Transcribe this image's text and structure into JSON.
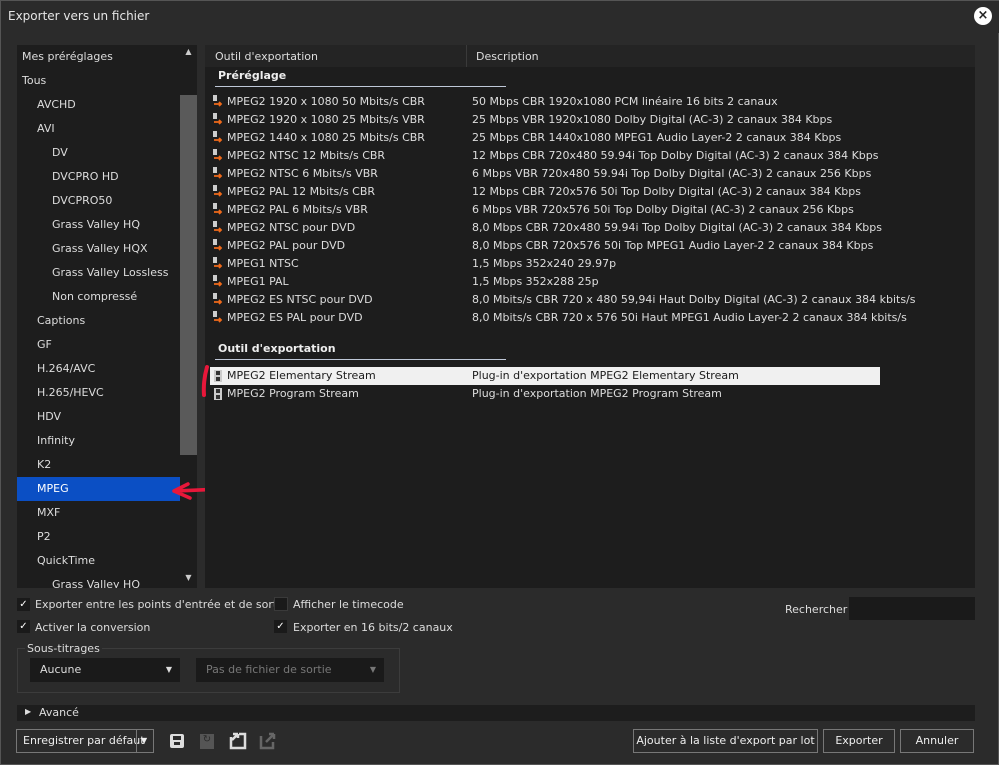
{
  "window": {
    "title": "Exporter vers un fichier",
    "close_icon": "close-icon"
  },
  "tree": {
    "items": [
      {
        "label": "Mes préréglages",
        "level": 0
      },
      {
        "label": "Tous",
        "level": 0
      },
      {
        "label": "AVCHD",
        "level": 1
      },
      {
        "label": "AVI",
        "level": 1
      },
      {
        "label": "DV",
        "level": 2
      },
      {
        "label": "DVCPRO HD",
        "level": 2
      },
      {
        "label": "DVCPRO50",
        "level": 2
      },
      {
        "label": "Grass Valley HQ",
        "level": 2
      },
      {
        "label": "Grass Valley HQX",
        "level": 2
      },
      {
        "label": "Grass Valley Lossless",
        "level": 2
      },
      {
        "label": "Non compressé",
        "level": 2
      },
      {
        "label": "Captions",
        "level": 1
      },
      {
        "label": "GF",
        "level": 1
      },
      {
        "label": "H.264/AVC",
        "level": 1
      },
      {
        "label": "H.265/HEVC",
        "level": 1
      },
      {
        "label": "HDV",
        "level": 1
      },
      {
        "label": "Infinity",
        "level": 1
      },
      {
        "label": "K2",
        "level": 1
      },
      {
        "label": "MPEG",
        "level": 1,
        "selected": true
      },
      {
        "label": "MXF",
        "level": 1
      },
      {
        "label": "P2",
        "level": 1
      },
      {
        "label": "QuickTime",
        "level": 1
      },
      {
        "label": "Grass Valley HQ",
        "level": 2
      }
    ]
  },
  "table": {
    "col_tool": "Outil d'exportation",
    "col_desc": "Description",
    "presets_title": "Préréglage",
    "presets": [
      {
        "name": "MPEG2 1920 x 1080 50 Mbits/s CBR",
        "desc": "50 Mbps CBR 1920x1080 PCM linéaire 16 bits 2 canaux"
      },
      {
        "name": "MPEG2 1920 x 1080 25 Mbits/s VBR",
        "desc": "25 Mbps VBR 1920x1080 Dolby Digital (AC-3) 2 canaux 384 Kbps"
      },
      {
        "name": "MPEG2 1440 x 1080 25 Mbits/s CBR",
        "desc": "25 Mbps CBR 1440x1080 MPEG1 Audio Layer-2 2 canaux 384 Kbps"
      },
      {
        "name": "MPEG2 NTSC 12 Mbits/s CBR",
        "desc": "12 Mbps CBR 720x480 59.94i Top Dolby Digital (AC-3) 2 canaux 384 Kbps"
      },
      {
        "name": "MPEG2 NTSC 6 Mbits/s VBR",
        "desc": "6 Mbps VBR 720x480 59.94i Top Dolby Digital (AC-3) 2 canaux 256 Kbps"
      },
      {
        "name": "MPEG2 PAL 12 Mbits/s CBR",
        "desc": "12 Mbps CBR 720x576 50i Top Dolby Digital (AC-3) 2 canaux 384 Kbps"
      },
      {
        "name": "MPEG2 PAL 6 Mbits/s VBR",
        "desc": "6 Mbps VBR 720x576 50i Top Dolby Digital (AC-3) 2 canaux 256 Kbps"
      },
      {
        "name": "MPEG2 NTSC pour DVD",
        "desc": "8,0 Mbps CBR 720x480 59.94i Top Dolby Digital (AC-3) 2 canaux 384 Kbps"
      },
      {
        "name": "MPEG2 PAL pour DVD",
        "desc": "8,0 Mbps CBR 720x576 50i Top MPEG1 Audio Layer-2 2 canaux 384 Kbps"
      },
      {
        "name": "MPEG1 NTSC",
        "desc": "1,5 Mbps 352x240 29.97p"
      },
      {
        "name": "MPEG1 PAL",
        "desc": "1,5 Mbps 352x288 25p"
      },
      {
        "name": "MPEG2 ES NTSC pour DVD",
        "desc": "8,0 Mbits/s CBR 720 x 480 59,94i Haut Dolby Digital (AC-3) 2 canaux 384 kbits/s"
      },
      {
        "name": "MPEG2 ES PAL pour DVD",
        "desc": "8,0 Mbits/s CBR 720 x 576 50i Haut MPEG1 Audio Layer-2 2 canaux 384 kbits/s"
      }
    ],
    "tools_title": "Outil d'exportation",
    "tools": [
      {
        "name": "MPEG2 Elementary Stream",
        "desc": "Plug-in d'exportation MPEG2 Elementary Stream",
        "selected": true
      },
      {
        "name": "MPEG2 Program Stream",
        "desc": "Plug-in d'exportation MPEG2 Program Stream"
      }
    ]
  },
  "options": {
    "export_inout": {
      "label": "Exporter entre les points d'entrée et de sortie",
      "checked": true
    },
    "show_timecode": {
      "label": "Afficher le timecode",
      "checked": false
    },
    "enable_conversion": {
      "label": "Activer la conversion",
      "checked": true
    },
    "export_16bit": {
      "label": "Exporter en 16 bits/2 canaux",
      "checked": true
    },
    "search_label": "Rechercher",
    "search_value": ""
  },
  "subtitles": {
    "title": "Sous-titrages",
    "type": "Aucune",
    "file": "Pas de fichier de sortie"
  },
  "advanced": "Avancé",
  "footer": {
    "save_default": "Enregistrer par défaut",
    "add_batch": "Ajouter à la liste d'export par lot",
    "export": "Exporter",
    "cancel": "Annuler"
  },
  "colors": {
    "selection": "#0b4fc4",
    "annotation": "#e8173a"
  }
}
